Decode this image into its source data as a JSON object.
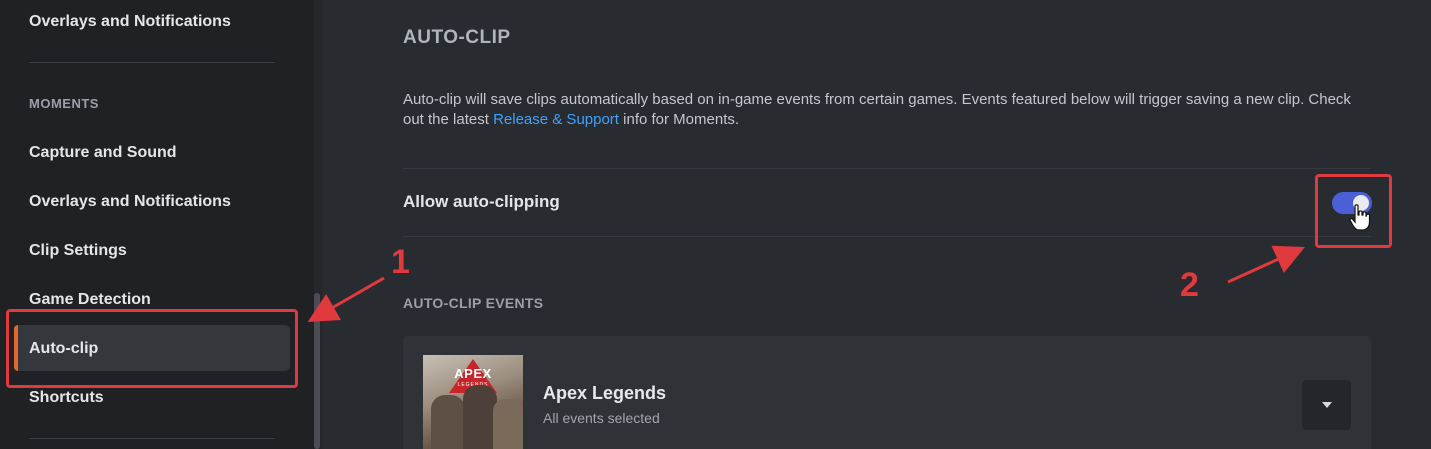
{
  "sidebar": {
    "items": [
      {
        "label": "Overlays and Notifications"
      },
      {
        "label": "Capture and Sound"
      },
      {
        "label": "Overlays and Notifications"
      },
      {
        "label": "Clip Settings"
      },
      {
        "label": "Game Detection"
      },
      {
        "label": "Auto-clip",
        "active": true
      },
      {
        "label": "Shortcuts"
      }
    ],
    "section_heading": "MOMENTS"
  },
  "main": {
    "title": "AUTO-CLIP",
    "description": {
      "before_link": "Auto-clip will save clips automatically based on in-game events from certain games. Events featured below will trigger saving a new clip. Check out the latest ",
      "link_text": "Release & Support",
      "after_link": " info for Moments."
    },
    "toggle": {
      "label": "Allow auto-clipping",
      "on": true
    },
    "events_heading": "AUTO-CLIP EVENTS",
    "games": [
      {
        "name": "Apex Legends",
        "subtitle": "All events selected",
        "art_text": "APEX",
        "art_subtext": "LEGENDS"
      }
    ]
  },
  "annotations": {
    "step1": "1",
    "step2": "2"
  },
  "colors": {
    "accent_active": "#e8652c",
    "toggle_on": "#4b5fd6",
    "link": "#3fa2ff",
    "annotation": "#e0393e"
  },
  "icons": {
    "dropdown": "chevron-down-icon",
    "cursor": "hand-pointer-icon"
  }
}
